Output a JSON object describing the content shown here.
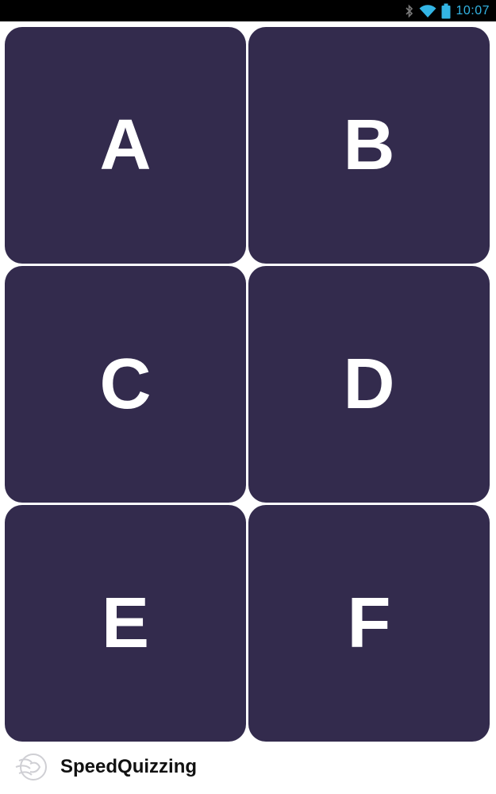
{
  "status_bar": {
    "time": "10:07",
    "icons": [
      "bluetooth-icon",
      "wifi-icon",
      "battery-icon"
    ],
    "accent_color": "#33b5e5"
  },
  "answer_grid": {
    "tile_color": "#332b4d",
    "letter_color": "#ffffff",
    "options": [
      {
        "label": "A"
      },
      {
        "label": "B"
      },
      {
        "label": "C"
      },
      {
        "label": "D"
      },
      {
        "label": "E"
      },
      {
        "label": "F"
      }
    ]
  },
  "footer": {
    "brand_name": "SpeedQuizzing",
    "logo_icon": "speedquizzing-logo-icon"
  }
}
